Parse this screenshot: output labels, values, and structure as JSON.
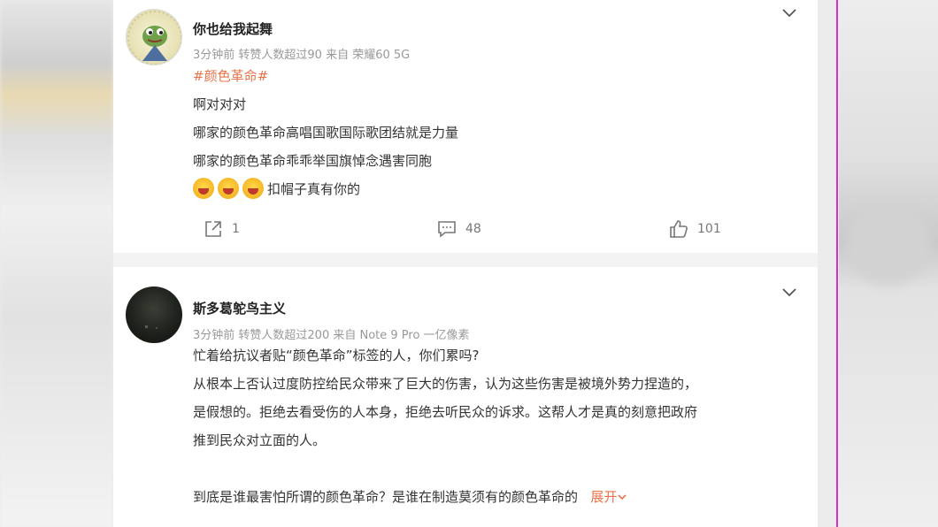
{
  "posts": [
    {
      "username": "你也给我起舞",
      "meta": "3分钟前 转赞人数超过90 来自 荣耀60 5G",
      "hashtag": "#颜色革命#",
      "lines": [
        "啊对对对",
        "哪家的颜色革命高唱国歌国际歌团结就是力量",
        "哪家的颜色革命乖乖举国旗悼念遇害同胞"
      ],
      "emoji_line_text": "扣帽子真有你的",
      "emoji_icon": "crying-face-icon",
      "repost_count": "1",
      "comment_count": "48",
      "like_count": "101"
    },
    {
      "username": "斯多葛鸵鸟主义",
      "meta": "3分钟前 转赞人数超过200 来自 Note 9 Pro 一亿像素",
      "lines": [
        "忙着给抗议者贴“颜色革命”标签的人，你们累吗?",
        "从根本上否认过度防控给民众带来了巨大的伤害，认为这些伤害是被境外势力捏造的，",
        "是假想的。拒绝去看受伤的人本身，拒绝去听民众的诉求。这帮人才是真的刻意把政府",
        "推到民众对立面的人。",
        "到底是谁最害怕所谓的颜色革命？是谁在制造莫须有的颜色革命的"
      ],
      "expand_label": "展开"
    }
  ],
  "colors": {
    "accent": "#e8734a",
    "divider": "#d530c8"
  }
}
